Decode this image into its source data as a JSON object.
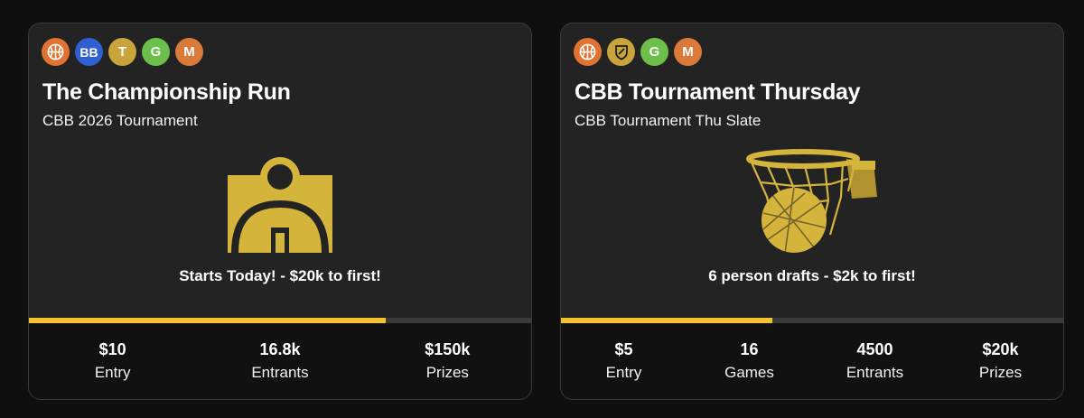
{
  "colors": {
    "accent": "#f2c230",
    "art_gold": "#d4b43a",
    "badge_basketball": "#e2722f",
    "badge_bb": "#2f5fd0",
    "badge_t": "#c8a43a",
    "badge_g": "#6cbf4a",
    "badge_m": "#d97a3a",
    "badge_shield": "#c8a43a"
  },
  "cards": [
    {
      "title": "The Championship Run",
      "subtitle": "CBB 2026 Tournament",
      "badges": [
        {
          "icon": "basketball-icon"
        },
        {
          "label": "BB"
        },
        {
          "label": "T"
        },
        {
          "label": "G"
        },
        {
          "label": "M"
        }
      ],
      "art_icon": "basketball-court-icon",
      "tagline": "Starts Today! - $20k to first!",
      "progress": 0.71,
      "stats": [
        {
          "value": "$10",
          "label": "Entry"
        },
        {
          "value": "16.8k",
          "label": "Entrants"
        },
        {
          "value": "$150k",
          "label": "Prizes"
        }
      ]
    },
    {
      "title": "CBB Tournament Thursday",
      "subtitle": "CBB Tournament Thu Slate",
      "badges": [
        {
          "icon": "basketball-icon"
        },
        {
          "icon": "shield-icon"
        },
        {
          "label": "G"
        },
        {
          "label": "M"
        }
      ],
      "art_icon": "basketball-hoop-icon",
      "tagline": "6 person drafts - $2k to first!",
      "progress": 0.42,
      "stats": [
        {
          "value": "$5",
          "label": "Entry"
        },
        {
          "value": "16",
          "label": "Games"
        },
        {
          "value": "4500",
          "label": "Entrants"
        },
        {
          "value": "$20k",
          "label": "Prizes"
        }
      ]
    }
  ]
}
